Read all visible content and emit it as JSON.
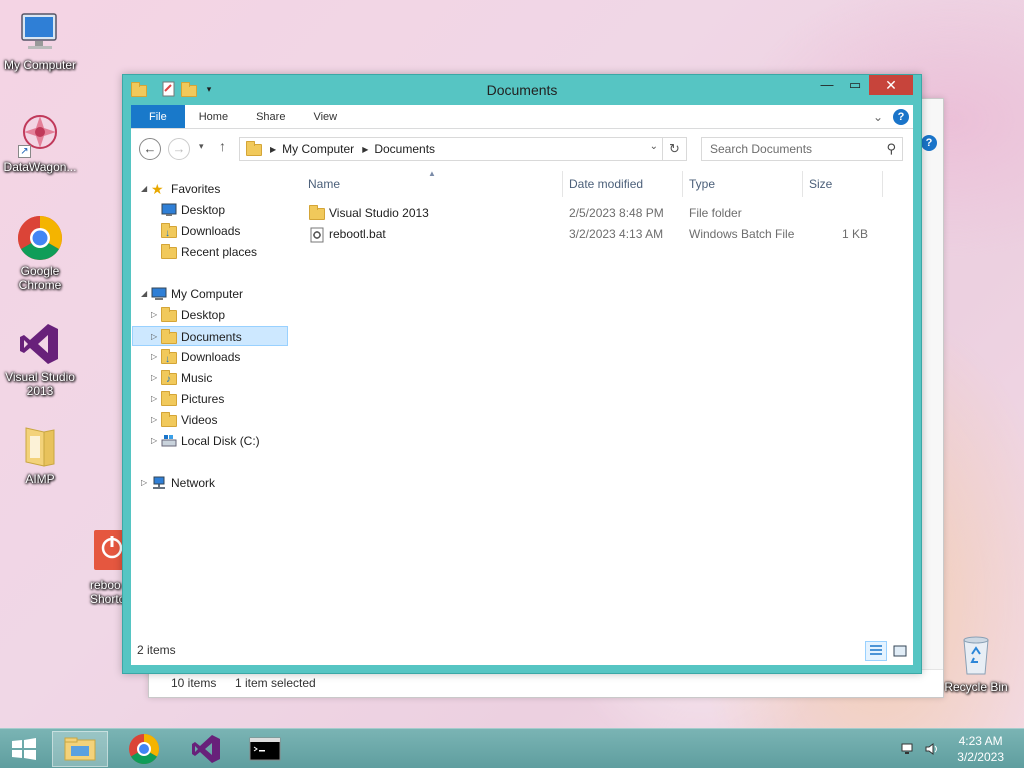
{
  "desktop": {
    "icons": [
      {
        "label": "My Computer"
      },
      {
        "label": "DataWagon..."
      },
      {
        "label": "Google Chrome"
      },
      {
        "label": "Visual Studio 2013"
      },
      {
        "label": "AIMP"
      },
      {
        "label": "reboo\nShortc"
      },
      {
        "label": "Recycle Bin"
      }
    ]
  },
  "background_window": {
    "status_items": "10 items",
    "status_selected": "1 item selected"
  },
  "window": {
    "title": "Documents",
    "ribbon_tabs": [
      "File",
      "Home",
      "Share",
      "View"
    ],
    "address": {
      "crumbs": [
        "My Computer",
        "Documents"
      ]
    },
    "search": {
      "placeholder": "Search Documents"
    },
    "nav": {
      "favorites": {
        "label": "Favorites",
        "items": [
          "Desktop",
          "Downloads",
          "Recent places"
        ]
      },
      "computer": {
        "label": "My Computer",
        "items": [
          "Desktop",
          "Documents",
          "Downloads",
          "Music",
          "Pictures",
          "Videos",
          "Local Disk (C:)"
        ]
      },
      "network": {
        "label": "Network"
      },
      "selected": "Documents"
    },
    "columns": [
      "Name",
      "Date modified",
      "Type",
      "Size"
    ],
    "files": [
      {
        "name": "Visual Studio 2013",
        "date": "2/5/2023 8:48 PM",
        "type": "File folder",
        "size": "",
        "icon": "folder-icon"
      },
      {
        "name": "rebootl.bat",
        "date": "3/2/2023 4:13 AM",
        "type": "Windows Batch File",
        "size": "1 KB",
        "icon": "batch-file-icon"
      }
    ],
    "status": "2 items"
  },
  "taskbar": {
    "time": "4:23 AM",
    "date": "3/2/2023"
  },
  "colors": {
    "window_frame": "#56c5c3",
    "accent": "#1979ca",
    "selection": "#cde8ff",
    "close_button": "#c7443b"
  }
}
